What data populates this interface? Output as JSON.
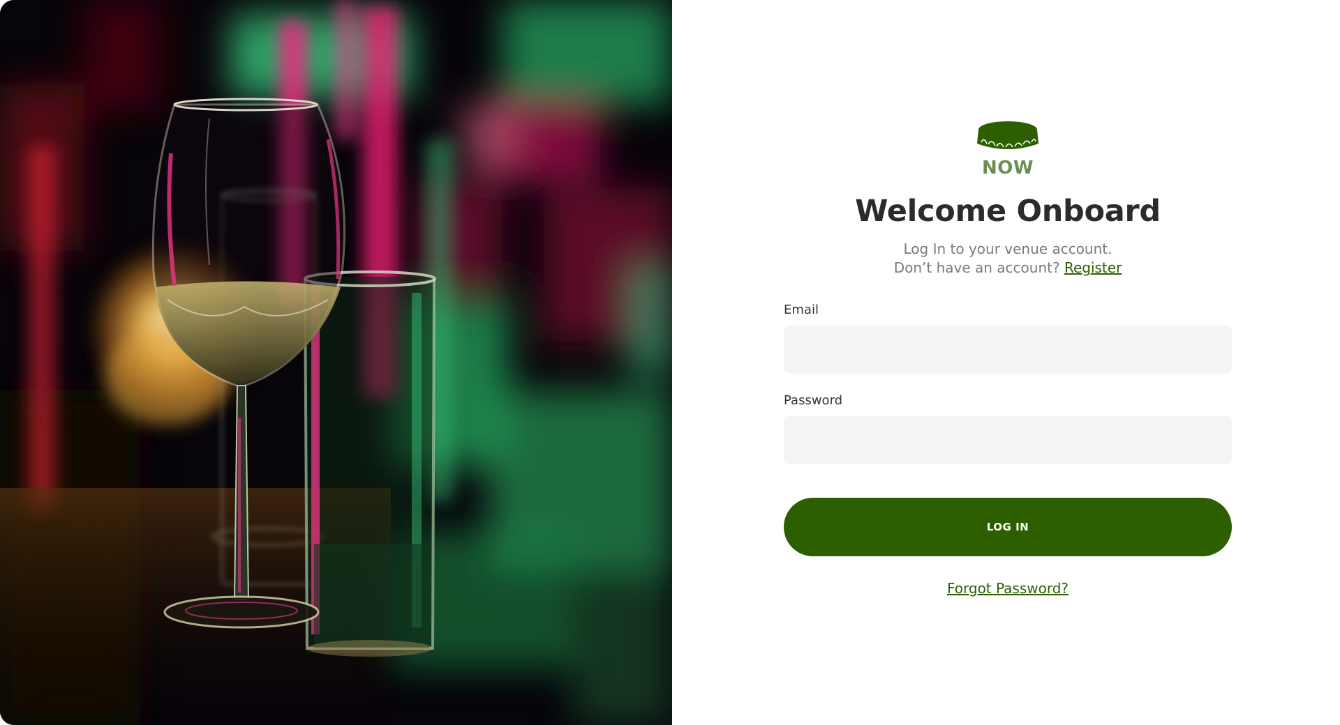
{
  "colors": {
    "brand_green": "#2d5f00",
    "brand_word_green": "#6b8f4e",
    "input_background": "#f4f4f4",
    "title_text": "#2b2b2b",
    "subtitle_text": "#7a7a7a"
  },
  "hero": {
    "icon": "wine-bar-photo"
  },
  "brand": {
    "icon": "bottle-cap-icon",
    "word": "NOW"
  },
  "login": {
    "title": "Welcome Onboard",
    "subtitle_line1": "Log In to your venue account.",
    "subtitle_line2_prefix": "Don’t have an account?",
    "register_link": "Register",
    "email_label": "Email",
    "email_value": "",
    "email_placeholder": "",
    "password_label": "Password",
    "password_value": "",
    "password_placeholder": "",
    "submit_label": "LOG IN",
    "forgot_link": "Forgot Password?"
  }
}
